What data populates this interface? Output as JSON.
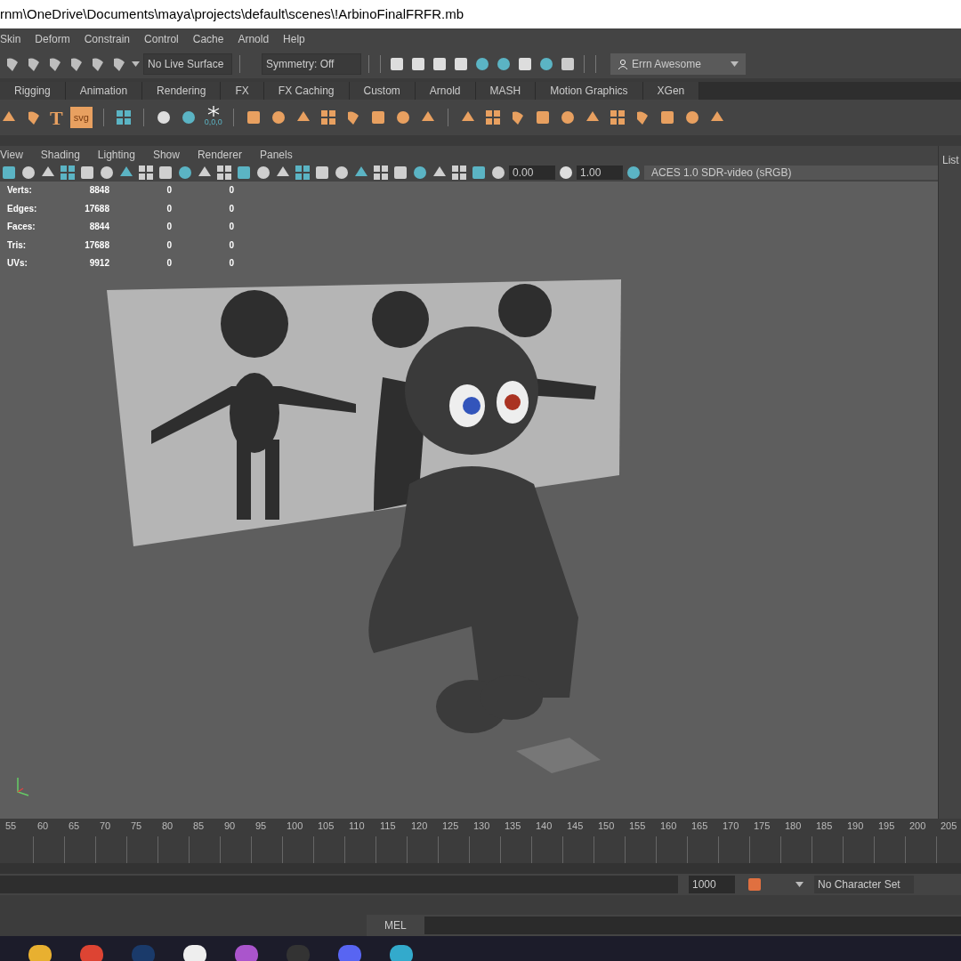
{
  "window": {
    "title": "rnm\\OneDrive\\Documents\\maya\\projects\\default\\scenes\\!ArbinoFinalFRFR.mb"
  },
  "menu": [
    "Skin",
    "Deform",
    "Constrain",
    "Control",
    "Cache",
    "Arnold",
    "Help"
  ],
  "status_line": {
    "live_surface": "No Live Surface",
    "symmetry": "Symmetry: Off",
    "account": "Errn Awesome"
  },
  "shelf_tabs": [
    {
      "label": "Rigging",
      "selected": false
    },
    {
      "label": "Animation",
      "selected": false
    },
    {
      "label": "Rendering",
      "selected": false
    },
    {
      "label": "FX",
      "selected": false
    },
    {
      "label": "FX Caching",
      "selected": false
    },
    {
      "label": "Custom",
      "selected": false
    },
    {
      "label": "Arnold",
      "selected": false
    },
    {
      "label": "MASH",
      "selected": false
    },
    {
      "label": "Motion Graphics",
      "selected": false
    },
    {
      "label": "XGen",
      "selected": false
    }
  ],
  "shelf_text_icons": [
    "svg"
  ],
  "text_tool_glyph": "T",
  "shelf_snap_label": "0,0,0",
  "panel_menu": [
    "View",
    "Shading",
    "Lighting",
    "Show",
    "Renderer",
    "Panels"
  ],
  "panel_toolbar": {
    "exposure": "0.00",
    "gamma": "1.00",
    "color_space": "ACES 1.0 SDR-video (sRGB)"
  },
  "hud": [
    {
      "label": "Verts:",
      "values": [
        "8848",
        "0",
        "0"
      ]
    },
    {
      "label": "Edges:",
      "values": [
        "17688",
        "0",
        "0"
      ]
    },
    {
      "label": "Faces:",
      "values": [
        "8844",
        "0",
        "0"
      ]
    },
    {
      "label": "Tris:",
      "values": [
        "17688",
        "0",
        "0"
      ]
    },
    {
      "label": "UVs:",
      "values": [
        "9912",
        "0",
        "0"
      ]
    }
  ],
  "side_panel": {
    "label": "List"
  },
  "timeline": {
    "ticks": [
      "55",
      "60",
      "65",
      "70",
      "75",
      "80",
      "85",
      "90",
      "95",
      "100",
      "105",
      "110",
      "115",
      "120",
      "125",
      "130",
      "135",
      "140",
      "145",
      "150",
      "155",
      "160",
      "165",
      "170",
      "175",
      "180",
      "185",
      "190",
      "195",
      "200",
      "205"
    ]
  },
  "range": {
    "end": "1000",
    "character_set": "No Character Set"
  },
  "command_line": {
    "language": "MEL"
  }
}
